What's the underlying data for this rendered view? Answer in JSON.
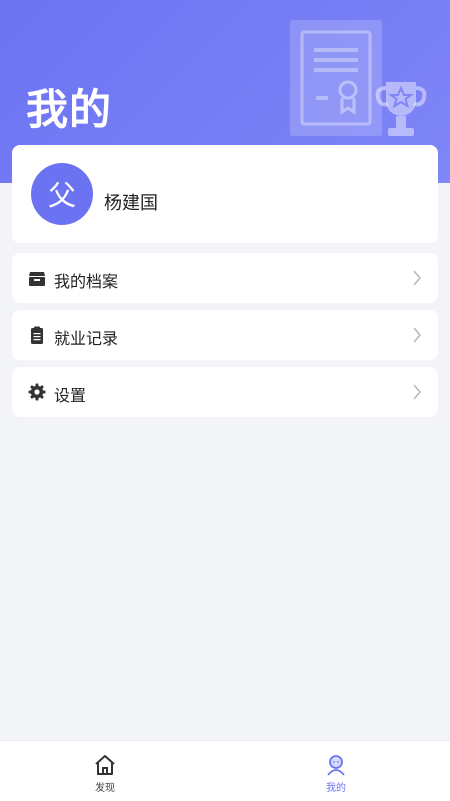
{
  "header": {
    "title": "我的"
  },
  "profile": {
    "avatar_text": "父",
    "name": "杨建国"
  },
  "menu": {
    "items": [
      {
        "label": "我的档案",
        "icon": "archive-box-icon"
      },
      {
        "label": "就业记录",
        "icon": "clipboard-icon"
      },
      {
        "label": "设置",
        "icon": "gear-icon"
      }
    ]
  },
  "tabbar": {
    "items": [
      {
        "label": "发现",
        "icon": "home-icon",
        "active": false
      },
      {
        "label": "我的",
        "icon": "user-icon",
        "active": true
      }
    ]
  },
  "colors": {
    "accent": "#6c73f2",
    "background": "#f3f4f8"
  }
}
